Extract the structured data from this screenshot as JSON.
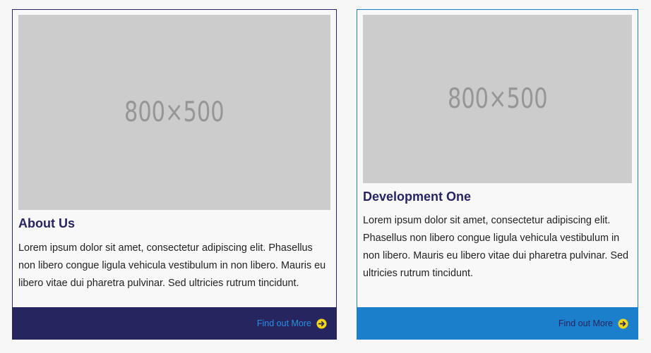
{
  "cards": [
    {
      "image_label": "800×500",
      "title": "About Us",
      "text": "Lorem ipsum dolor sit amet, consectetur adipiscing elit. Phasellus non libero congue ligula vehicula vestibulum in non libero. Mauris eu libero vitae dui pharetra pulvinar. Sed ultricies rutrum tincidunt.",
      "link_label": "Find out More",
      "icon": "arrow-right-circle-icon"
    },
    {
      "image_label": "800×500",
      "title": "Development One",
      "text": "Lorem ipsum dolor sit amet, consectetur adipiscing elit. Phasellus non libero congue ligula vehicula vestibulum in non libero. Mauris eu libero vitae dui pharetra pulvinar. Sed ultricies rutrum tincidunt.",
      "link_label": "Find out More",
      "icon": "arrow-right-circle-icon"
    }
  ],
  "colors": {
    "background": "#f7f7f7",
    "navy": "#26255f",
    "blue": "#1b7fcb",
    "link_blue": "#2a8fe3",
    "icon_yellow": "#f3d517",
    "placeholder_bg": "#cccccc",
    "placeholder_text": "#969696"
  }
}
